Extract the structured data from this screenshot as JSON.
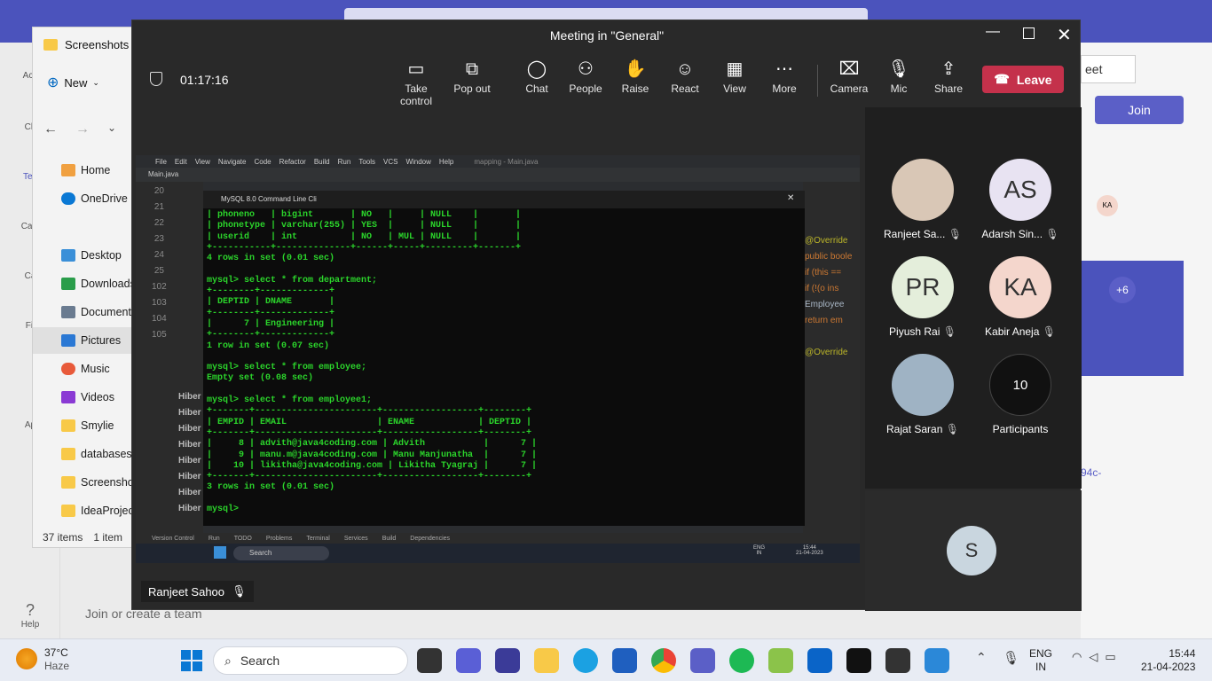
{
  "background": {
    "rail": [
      "Acti",
      "Ch",
      "Tea",
      "Cale",
      "Ca",
      "Fil",
      "Ap",
      "Help"
    ],
    "right_btn": "eet",
    "join_label": "Join",
    "badge_ka": "KA",
    "badge_plus": "+6",
    "link_frag": "94c-",
    "join_team": "Join or create a team"
  },
  "explorer": {
    "title": "Screenshots",
    "new_label": "New",
    "nav": [
      "Home",
      "OneDrive",
      "Desktop",
      "Downloads",
      "Documents",
      "Pictures",
      "Music",
      "Videos",
      "Smylie",
      "databases",
      "Screenshot",
      "IdeaProject"
    ],
    "status_items": "37 items",
    "status_sel": "1 item"
  },
  "meeting": {
    "title": "Meeting in \"General\"",
    "timer": "01:17:16",
    "toolbar": [
      "Take control",
      "Pop out",
      "Chat",
      "People",
      "Raise",
      "React",
      "View",
      "More",
      "Camera",
      "Mic",
      "Share"
    ],
    "leave": "Leave",
    "presenter": "Ranjeet Sahoo"
  },
  "ide": {
    "menu": [
      "File",
      "Edit",
      "View",
      "Navigate",
      "Code",
      "Refactor",
      "Build",
      "Run",
      "Tools",
      "VCS",
      "Window",
      "Help",
      "mapping - Main.java"
    ],
    "tab": "Main.java",
    "line_numbers": [
      "20",
      "21",
      "22",
      "23",
      "24",
      "25",
      "102",
      "103",
      "104",
      "105"
    ],
    "right_code": [
      "@Override",
      "public boole",
      "if (this ==",
      "if (!(o ins",
      "Employee",
      "return em",
      "@Override"
    ],
    "run_lines": [
      "Hiber",
      "Hiber",
      "Hiber",
      "Hiber",
      "Hiber",
      "Hiber",
      "Hiber",
      "Hiber"
    ],
    "bottom_tabs": [
      "Version Control",
      "Run",
      "TODO",
      "Problems",
      "Terminal",
      "Services",
      "Build",
      "Dependencies"
    ]
  },
  "terminal": {
    "title": "MySQL 8.0 Command Line Cli",
    "text": "| phoneno   | bigint       | NO   |     | NULL    |       |\n| phonetype | varchar(255) | YES  |     | NULL    |       |\n| userid    | int          | NO   | MUL | NULL    |       |\n+-----------+--------------+------+-----+---------+-------+\n4 rows in set (0.01 sec)\n\nmysql> select * from department;\n+--------+-------------+\n| DEPTID | DNAME       |\n+--------+-------------+\n|      7 | Engineering |\n+--------+-------------+\n1 row in set (0.07 sec)\n\nmysql> select * from employee;\nEmpty set (0.08 sec)\n\nmysql> select * from employee1;\n+-------+-----------------------+------------------+--------+\n| EMPID | EMAIL                 | ENAME            | DEPTID |\n+-------+-----------------------+------------------+--------+\n|     8 | advith@java4coding.com | Advith           |      7 |\n|     9 | manu.m@java4coding.com | Manu Manjunatha  |      7 |\n|    10 | likitha@java4coding.com | Likitha Tyagraj |      7 |\n+-------+-----------------------+------------------+--------+\n3 rows in set (0.01 sec)\n\nmysql>"
  },
  "inner_taskbar": {
    "search": "Search",
    "lang": "ENG",
    "region": "IN",
    "time": "15:44",
    "date": "21-04-2023"
  },
  "participants": [
    {
      "name": "Ranjeet Sa...",
      "initials": "",
      "color": "#d9c7b6"
    },
    {
      "name": "Adarsh Sin...",
      "initials": "AS",
      "color": "#e8e3f2"
    },
    {
      "name": "Piyush Rai",
      "initials": "PR",
      "color": "#e4eedb"
    },
    {
      "name": "Kabir Aneja",
      "initials": "KA",
      "color": "#f4d6cc"
    },
    {
      "name": "Rajat Saran",
      "initials": "",
      "color": "#9fb3c4"
    },
    {
      "name": "Participants",
      "initials": "10",
      "color": "#111111"
    }
  ],
  "self_initial": "S",
  "taskbar": {
    "temp": "37°C",
    "weather": "Haze",
    "search": "Search",
    "lang": "ENG",
    "region": "IN",
    "time": "15:44",
    "date": "21-04-2023"
  }
}
